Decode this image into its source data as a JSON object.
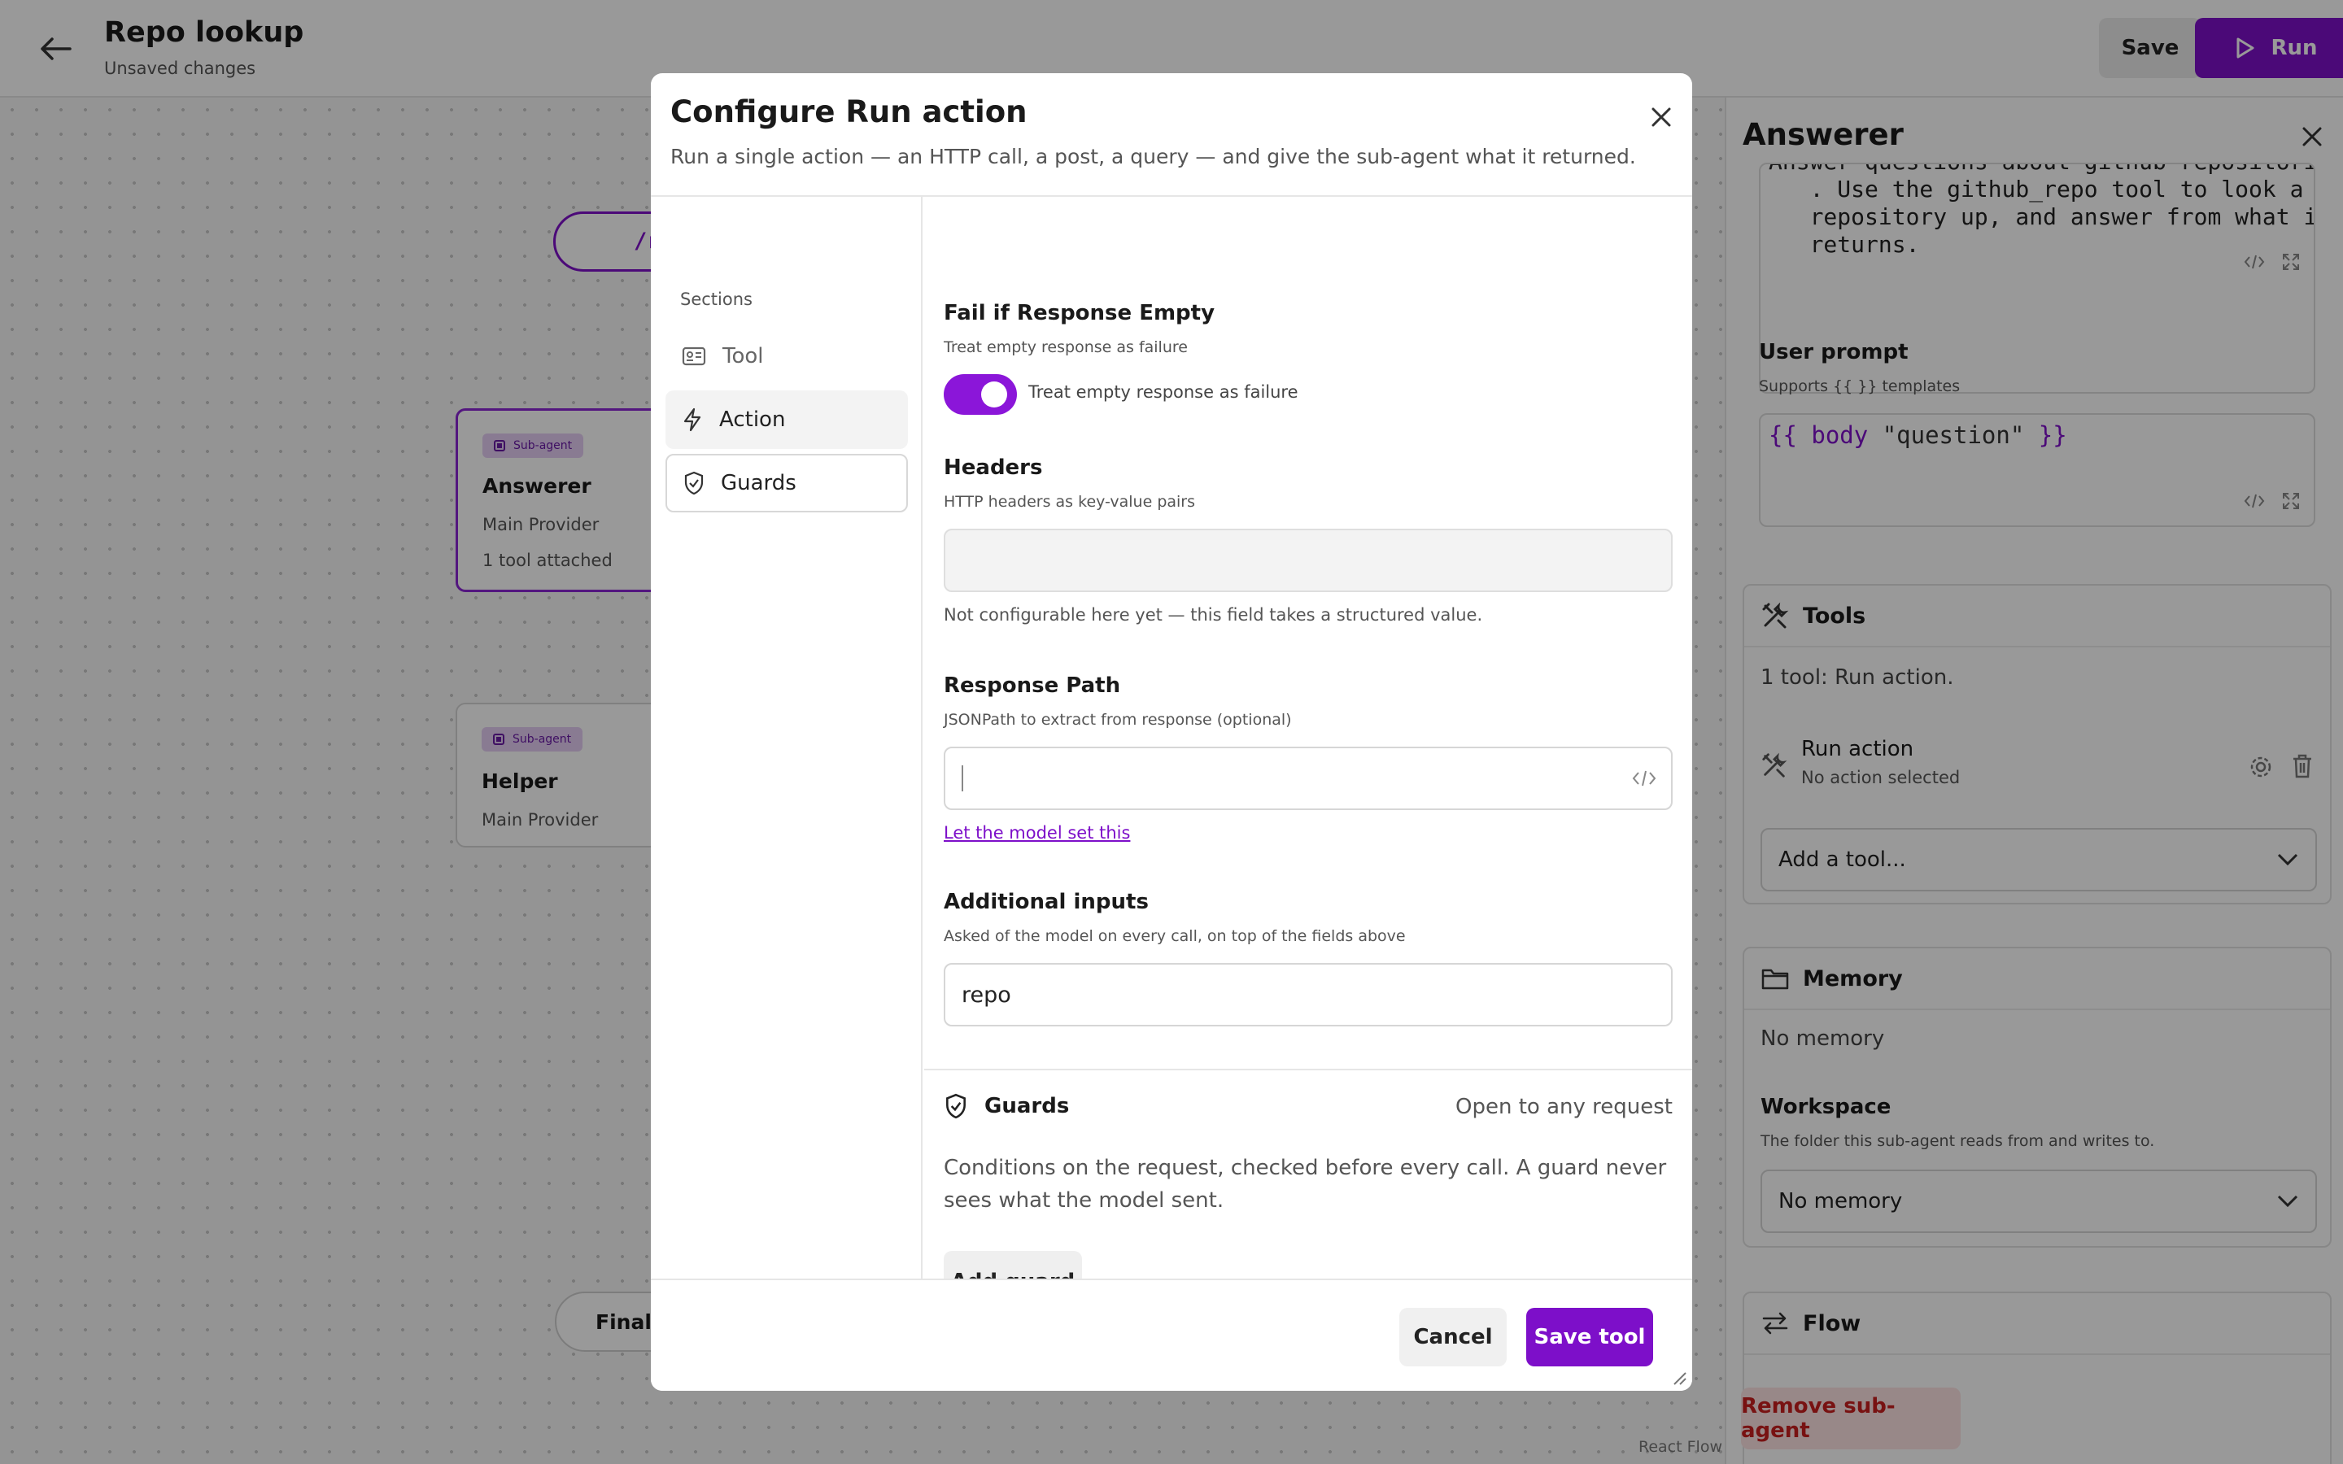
{
  "header": {
    "title": "Repo lookup",
    "subtitle": "Unsaved changes",
    "save_label": "Save",
    "run_label": "Run"
  },
  "canvas": {
    "start_node_label": "/r",
    "nodes": [
      {
        "badge": "Sub-agent",
        "title": "Answerer",
        "provider": "Main Provider",
        "tools": "1 tool attached"
      },
      {
        "badge": "Sub-agent",
        "title": "Helper",
        "provider": "Main Provider"
      }
    ],
    "final_node_label": "Final r",
    "credit": "React Flow"
  },
  "right_panel": {
    "title": "Answerer",
    "system_prompt_lines": [
      "Answer questions about github repositories",
      "   . Use the github_repo tool to look a",
      "   repository up, and answer from what it",
      "   returns."
    ],
    "user_prompt_label": "User prompt",
    "user_prompt_hint": "Supports {{ }} templates",
    "user_prompt_open": "{{",
    "user_prompt_fn": "body",
    "user_prompt_arg": "\"question\"",
    "user_prompt_close": "}}",
    "tools": {
      "title": "Tools",
      "summary": "1 tool: Run action.",
      "item_name": "Run action",
      "item_sub": "No action selected",
      "add_placeholder": "Add a tool..."
    },
    "memory": {
      "title": "Memory",
      "value": "No memory",
      "workspace_label": "Workspace",
      "workspace_hint": "The folder this sub-agent reads from and writes to.",
      "workspace_value": "No memory"
    },
    "flow": {
      "title": "Flow"
    },
    "remove_label": "Remove sub-agent"
  },
  "modal": {
    "title": "Configure Run action",
    "description": "Run a single action — an HTTP call, a post, a query — and give the sub-agent what it returned.",
    "sections_label": "Sections",
    "sections": [
      {
        "label": "Tool"
      },
      {
        "label": "Action"
      },
      {
        "label": "Guards"
      }
    ],
    "fail_empty": {
      "label": "Fail if Response Empty",
      "hint": "Treat empty response as failure",
      "toggle_text": "Treat empty response as failure",
      "enabled": true
    },
    "headers": {
      "label": "Headers",
      "hint": "HTTP headers as key-value pairs",
      "note": "Not configurable here yet — this field takes a structured value."
    },
    "response_path": {
      "label": "Response Path",
      "hint": "JSONPath to extract from response (optional)",
      "value": "",
      "link": "Let the model set this"
    },
    "additional_inputs": {
      "label": "Additional inputs",
      "hint": "Asked of the model on every call, on top of the fields above",
      "value": "repo"
    },
    "guards": {
      "title": "Guards",
      "status": "Open to any request",
      "description": "Conditions on the request, checked before every call. A guard never sees what the model sent.",
      "add_label": "Add guard"
    },
    "cancel_label": "Cancel",
    "save_label": "Save tool"
  },
  "colors": {
    "accent": "#7d0fc9",
    "danger": "#c81f1f"
  }
}
